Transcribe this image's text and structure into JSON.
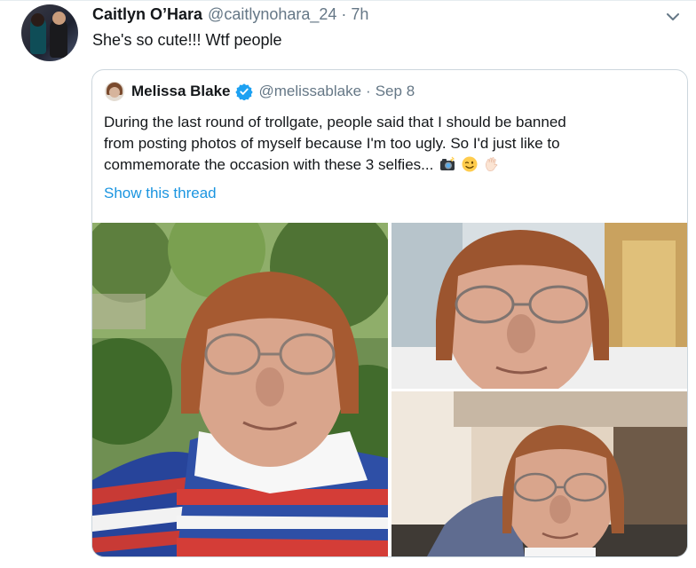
{
  "tweet": {
    "author_name": "Caitlyn O’Hara",
    "handle": "@caitlynohara_24",
    "separator": "·",
    "time": "7h",
    "text": "She's so cute!!! Wtf people",
    "avatar_icon": "couple-profile-photo"
  },
  "quoted_tweet": {
    "author_name": "Melissa Blake",
    "verified_icon": "verified-badge-icon",
    "handle": "@melissablake",
    "separator": "·",
    "date": "Sep 8",
    "text_lines": [
      "During the last round of trollgate, people said that I should be banned",
      "from posting photos of myself because I'm too ugly. So I'd just like to",
      "commemorate the occasion with these 3 selfies..."
    ],
    "emojis": [
      "camera-with-flash-emoji",
      "winking-face-emoji",
      "waving-hand-emoji"
    ],
    "show_thread_label": "Show this thread",
    "photos": [
      {
        "icon": "selfie-park-photo"
      },
      {
        "icon": "selfie-office-photo"
      },
      {
        "icon": "selfie-cafe-photo"
      }
    ]
  },
  "colors": {
    "link": "#1b95e0",
    "secondary_text": "#657786",
    "border": "#ccd6dd",
    "verified": "#1da1f2"
  }
}
